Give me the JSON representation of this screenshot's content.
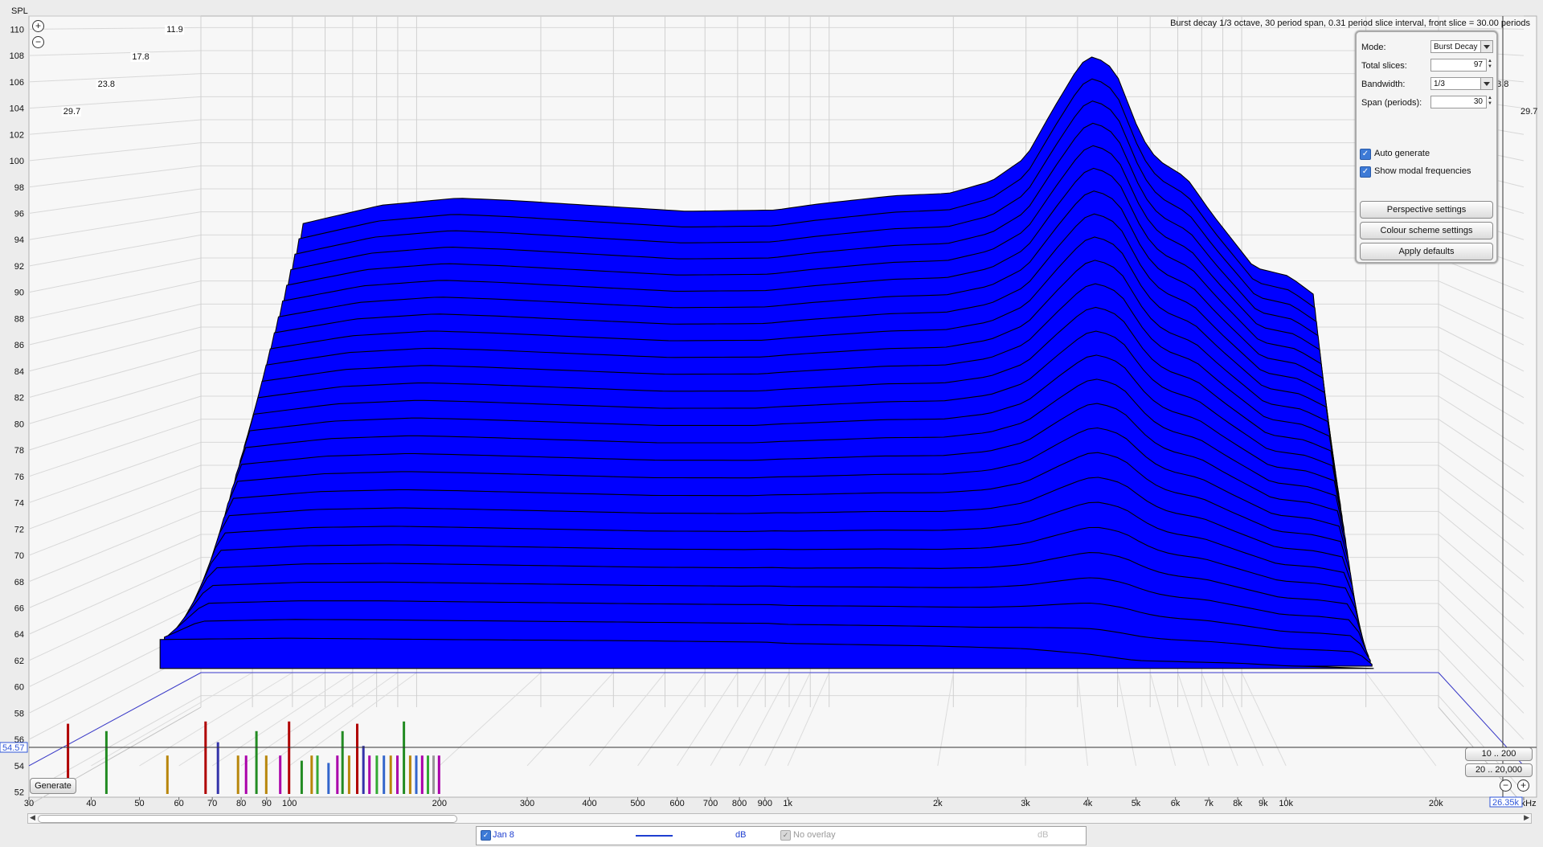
{
  "chart_data": {
    "type": "area",
    "title": "Burst decay 1/3 octave, 30 period span, 0.31 period slice interval,  front slice = 30.00 periods",
    "ylabel": "SPL",
    "xlabel": "",
    "y_ticks": [
      110,
      108,
      106,
      104,
      102,
      100,
      98,
      96,
      94,
      92,
      90,
      88,
      86,
      84,
      82,
      80,
      78,
      76,
      74,
      72,
      70,
      68,
      66,
      64,
      62,
      60,
      58,
      56,
      54,
      52
    ],
    "ylim": [
      51,
      111
    ],
    "x_scale": "log",
    "xlim_hz": [
      30,
      30000
    ],
    "x_ticks": [
      {
        "hz": 30,
        "label": "30"
      },
      {
        "hz": 40,
        "label": "40"
      },
      {
        "hz": 50,
        "label": "50"
      },
      {
        "hz": 60,
        "label": "60"
      },
      {
        "hz": 70,
        "label": "70"
      },
      {
        "hz": 80,
        "label": "80"
      },
      {
        "hz": 90,
        "label": "90"
      },
      {
        "hz": 100,
        "label": "100"
      },
      {
        "hz": 200,
        "label": "200"
      },
      {
        "hz": 300,
        "label": "300"
      },
      {
        "hz": 400,
        "label": "400"
      },
      {
        "hz": 500,
        "label": "500"
      },
      {
        "hz": 600,
        "label": "600"
      },
      {
        "hz": 700,
        "label": "700"
      },
      {
        "hz": 800,
        "label": "800"
      },
      {
        "hz": 900,
        "label": "900"
      },
      {
        "hz": 1000,
        "label": "1k"
      },
      {
        "hz": 2000,
        "label": "2k"
      },
      {
        "hz": 3000,
        "label": "3k"
      },
      {
        "hz": 4000,
        "label": "4k"
      },
      {
        "hz": 5000,
        "label": "5k"
      },
      {
        "hz": 6000,
        "label": "6k"
      },
      {
        "hz": 7000,
        "label": "7k"
      },
      {
        "hz": 8000,
        "label": "8k"
      },
      {
        "hz": 9000,
        "label": "9k"
      },
      {
        "hz": 10000,
        "label": "10k"
      },
      {
        "hz": 20000,
        "label": "20k"
      },
      {
        "hz": 30000,
        "label": "30kHz"
      }
    ],
    "depth_labels": [
      "11.9",
      "17.8",
      "23.8",
      "29.7"
    ],
    "cursor_spl": "54.57",
    "cursor_freq": "26.35k",
    "surface_color": "#0000ff",
    "slice_line_color": "#000000",
    "series": [
      {
        "slice_periods": 0,
        "values_hz_db": [
          [
            55,
            63.7
          ],
          [
            65,
            93.6
          ],
          [
            100,
            95.2
          ],
          [
            150,
            95.8
          ],
          [
            200,
            95.6
          ],
          [
            300,
            95.2
          ],
          [
            500,
            94.7
          ],
          [
            800,
            94.8
          ],
          [
            1000,
            95.3
          ],
          [
            1500,
            96.0
          ],
          [
            2000,
            96.2
          ],
          [
            2500,
            97.2
          ],
          [
            3000,
            99.2
          ],
          [
            3500,
            103.5
          ],
          [
            4000,
            107.0
          ],
          [
            4300,
            107.7
          ],
          [
            4800,
            106.5
          ],
          [
            5500,
            101.0
          ],
          [
            6000,
            99.0
          ],
          [
            7000,
            97.5
          ],
          [
            8000,
            94.5
          ],
          [
            10000,
            90.0
          ],
          [
            12000,
            89.3
          ],
          [
            14000,
            87.5
          ],
          [
            15000,
            64.6
          ]
        ]
      },
      {
        "slice_periods": 30,
        "values_hz_db": [
          [
            55,
            63.6
          ],
          [
            100,
            63.7
          ],
          [
            200,
            63.6
          ],
          [
            500,
            63.5
          ],
          [
            900,
            63.4
          ],
          [
            1000,
            63.3
          ],
          [
            2000,
            63.1
          ],
          [
            3000,
            62.9
          ],
          [
            4000,
            62.5
          ],
          [
            5000,
            62.0
          ],
          [
            8000,
            61.8
          ],
          [
            10000,
            61.6
          ],
          [
            15000,
            61.4
          ]
        ]
      }
    ],
    "modal_frequencies": [
      {
        "hz": 36,
        "h": 0.95,
        "c": "#b00000"
      },
      {
        "hz": 43,
        "h": 0.85,
        "c": "#228b22"
      },
      {
        "hz": 57,
        "h": 0.52,
        "c": "#b8860b"
      },
      {
        "hz": 68,
        "h": 0.98,
        "c": "#b00000"
      },
      {
        "hz": 72,
        "h": 0.7,
        "c": "#3333aa"
      },
      {
        "hz": 79,
        "h": 0.52,
        "c": "#b8860b"
      },
      {
        "hz": 82,
        "h": 0.52,
        "c": "#aa00aa"
      },
      {
        "hz": 86,
        "h": 0.85,
        "c": "#228b22"
      },
      {
        "hz": 90,
        "h": 0.52,
        "c": "#b8860b"
      },
      {
        "hz": 96,
        "h": 0.52,
        "c": "#aa00aa"
      },
      {
        "hz": 100,
        "h": 0.98,
        "c": "#b00000"
      },
      {
        "hz": 106,
        "h": 0.45,
        "c": "#228b22"
      },
      {
        "hz": 111,
        "h": 0.52,
        "c": "#b8860b"
      },
      {
        "hz": 114,
        "h": 0.52,
        "c": "#33aa33"
      },
      {
        "hz": 120,
        "h": 0.42,
        "c": "#3366cc"
      },
      {
        "hz": 125,
        "h": 0.52,
        "c": "#aa00aa"
      },
      {
        "hz": 128,
        "h": 0.85,
        "c": "#228b22"
      },
      {
        "hz": 132,
        "h": 0.52,
        "c": "#b8860b"
      },
      {
        "hz": 137,
        "h": 0.95,
        "c": "#b00000"
      },
      {
        "hz": 141,
        "h": 0.65,
        "c": "#3333aa"
      },
      {
        "hz": 145,
        "h": 0.52,
        "c": "#aa00aa"
      },
      {
        "hz": 150,
        "h": 0.52,
        "c": "#33aa33"
      },
      {
        "hz": 155,
        "h": 0.52,
        "c": "#3366cc"
      },
      {
        "hz": 160,
        "h": 0.52,
        "c": "#b8860b"
      },
      {
        "hz": 165,
        "h": 0.52,
        "c": "#aa00aa"
      },
      {
        "hz": 170,
        "h": 0.98,
        "c": "#228b22"
      },
      {
        "hz": 175,
        "h": 0.52,
        "c": "#b8860b"
      },
      {
        "hz": 180,
        "h": 0.52,
        "c": "#3366cc"
      },
      {
        "hz": 185,
        "h": 0.52,
        "c": "#aa00aa"
      },
      {
        "hz": 190,
        "h": 0.52,
        "c": "#33aa33"
      },
      {
        "hz": 195,
        "h": 0.52,
        "c": "#999999"
      },
      {
        "hz": 200,
        "h": 0.52,
        "c": "#aa00aa"
      }
    ]
  },
  "panel": {
    "mode_label": "Mode:",
    "mode_value": "Burst Decay",
    "slices_label": "Total slices:",
    "slices_value": "97",
    "bandwidth_label": "Bandwidth:",
    "bandwidth_value": "1/3",
    "span_label": "Span (periods):",
    "span_value": "30",
    "auto_generate": "Auto generate",
    "show_modal": "Show modal frequencies",
    "perspective_btn": "Perspective settings",
    "colour_btn": "Colour scheme settings",
    "defaults_btn": "Apply defaults"
  },
  "buttons": {
    "generate": "Generate",
    "range_low": "10 .. 200",
    "range_full": "20 .. 20,000"
  },
  "legend": {
    "series_name": "Jan 8",
    "series_color": "#1f3fd0",
    "unit": "dB",
    "overlay": "No overlay",
    "overlay_unit": "dB"
  }
}
